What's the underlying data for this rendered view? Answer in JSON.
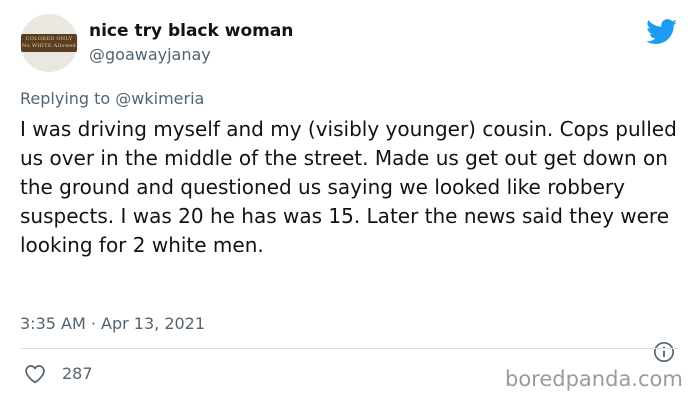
{
  "author": {
    "display_name": "nice try black woman",
    "handle": "@goawayjanay",
    "avatar_sign_text": "COLORED ONLY\nNo WHITE Allowed"
  },
  "reply": {
    "prefix": "Replying to ",
    "mention": "@wkimeria"
  },
  "tweet": {
    "text": "I was driving myself and my (visibly younger) cousin. Cops pulled us over in the middle of the street. Made us get out get down on the ground and questioned us saying we looked like robbery suspects. I was 20 he has was 15. Later the news said they were looking for 2 white men."
  },
  "meta": {
    "timestamp": "3:35 AM · Apr 13, 2021"
  },
  "actions": {
    "like_count": "287"
  },
  "watermark": "boredpanda.com",
  "colors": {
    "brand_blue": "#1d9bf0",
    "secondary_text": "#536471",
    "primary_text": "#0f1419"
  },
  "icons": {
    "brand": "twitter-bird-icon",
    "info": "info-icon",
    "like": "heart-icon"
  }
}
